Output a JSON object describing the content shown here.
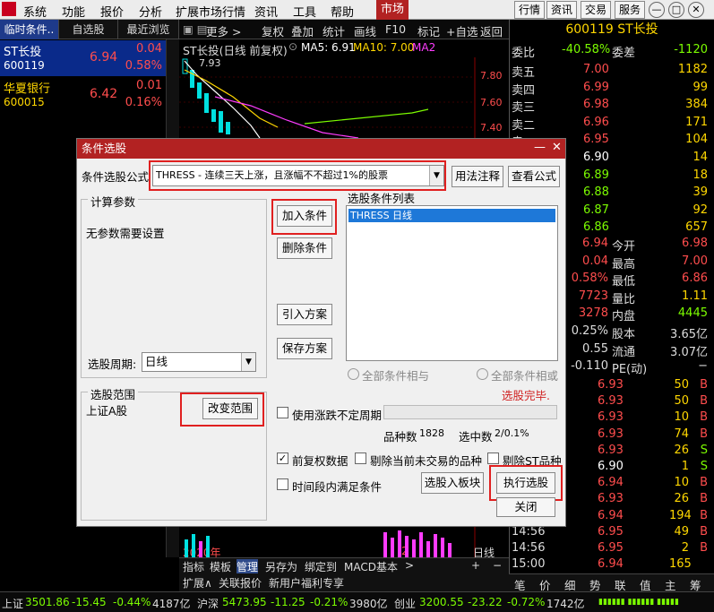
{
  "menubar": {
    "items": [
      "系统",
      "功能",
      "报价",
      "分析",
      "扩展市场行情",
      "资讯",
      "工具",
      "帮助"
    ],
    "market": "市场",
    "right_buttons": [
      "行情",
      "资讯",
      "交易",
      "服务"
    ],
    "window_controls": [
      "—",
      "□",
      "✕"
    ]
  },
  "left_tabs": [
    "临时条件..",
    "自选股",
    "最近浏览"
  ],
  "stocks": [
    {
      "name": "ST长投",
      "code": "600119",
      "price": "6.94",
      "change": "0.04",
      "pct": "0.58%"
    },
    {
      "name": "华夏银行",
      "code": "600015",
      "price": "6.42",
      "change": "0.01",
      "pct": "0.16%"
    }
  ],
  "chart_toolbar": {
    "more": "更多 >",
    "items": [
      "复权",
      "叠加",
      "统计",
      "画线",
      "F10",
      "标记",
      "+自选",
      "返回"
    ]
  },
  "chart": {
    "title": "ST长投(日线 前复权)",
    "ma5": "MA5: 6.91",
    "ma10": "MA10: 7.00",
    "ma2": "MA2",
    "high_label": "7.93",
    "prices": [
      "7.80",
      "7.60",
      "7.40"
    ],
    "year": "2020年",
    "right_label": "日线",
    "small_label": "2"
  },
  "chart_bottom": [
    "指标",
    "模板",
    "管理",
    "另存为",
    "绑定到",
    "MACD基本",
    ">",
    "+",
    "−"
  ],
  "ext_bar": [
    "扩展∧",
    "关联报价",
    "新用户福利专享"
  ],
  "right": {
    "header": "600119 ST长投",
    "webi": {
      "label": "委比",
      "value": "-40.58%",
      "label2": "委差",
      "value2": "-1120"
    },
    "sell": [
      {
        "l": "卖五",
        "p": "7.00",
        "v": "1182"
      },
      {
        "l": "卖四",
        "p": "6.99",
        "v": "99"
      },
      {
        "l": "卖三",
        "p": "6.98",
        "v": "384"
      },
      {
        "l": "卖二",
        "p": "6.96",
        "v": "171"
      },
      {
        "l": "卖一",
        "p": "6.95",
        "v": "104"
      }
    ],
    "buy": [
      {
        "p": "6.90",
        "v": "14"
      },
      {
        "p": "6.89",
        "v": "18"
      },
      {
        "p": "6.88",
        "v": "39"
      },
      {
        "p": "6.87",
        "v": "92"
      },
      {
        "p": "6.86",
        "v": "657"
      }
    ],
    "info": [
      {
        "a": "6.94",
        "l": "今开",
        "b": "6.98"
      },
      {
        "a": "0.04",
        "l": "最高",
        "b": "7.00"
      },
      {
        "a": "0.58%",
        "l": "最低",
        "b": "6.86"
      },
      {
        "a": "7723",
        "l": "量比",
        "b": "1.11"
      },
      {
        "a": "3278",
        "l": "内盘",
        "b": "4445"
      }
    ],
    "info2": [
      {
        "a": "0.25%",
        "l": "股本",
        "b": "3.65亿"
      },
      {
        "a": "0.55",
        "l": "流通",
        "b": "3.07亿"
      },
      {
        "a": "-0.110",
        "l": "PE(动)",
        "b": "−"
      }
    ],
    "ticks": [
      {
        "t": "",
        "p": "6.93",
        "v": "50",
        "s": "B"
      },
      {
        "t": "",
        "p": "6.93",
        "v": "50",
        "s": "B"
      },
      {
        "t": "",
        "p": "6.93",
        "v": "10",
        "s": "B"
      },
      {
        "t": "",
        "p": "6.93",
        "v": "74",
        "s": "B"
      },
      {
        "t": "",
        "p": "6.93",
        "v": "26",
        "s": "S"
      },
      {
        "t": "",
        "p": "6.90",
        "v": "1",
        "s": "S"
      },
      {
        "t": "",
        "p": "6.94",
        "v": "10",
        "s": "B"
      },
      {
        "t": "",
        "p": "6.93",
        "v": "26",
        "s": "B"
      },
      {
        "t": "",
        "p": "6.94",
        "v": "194",
        "s": "B"
      },
      {
        "t": "14:56",
        "p": "6.95",
        "v": "49",
        "s": "B"
      },
      {
        "t": "14:56",
        "p": "6.95",
        "v": "2",
        "s": "B"
      },
      {
        "t": "15:00",
        "p": "6.94",
        "v": "165",
        "s": ""
      }
    ],
    "bottom_tabs": [
      "笔",
      "价",
      "细",
      "势",
      "联",
      "值",
      "主",
      "筹"
    ]
  },
  "dialog": {
    "title": "条件选股",
    "formula_label": "条件选股公式",
    "formula_value": "THRESS      - 连续三天上涨，且涨幅不不超过1%的股票",
    "btn_usage": "用法注释",
    "btn_view": "查看公式",
    "calc_params": "计算参数",
    "no_params": "无参数需要设置",
    "btn_add": "加入条件",
    "btn_delete": "删除条件",
    "btn_import": "引入方案",
    "btn_save": "保存方案",
    "cond_list_label": "选股条件列表",
    "cond_items": [
      "THRESS  日线"
    ],
    "period_label": "选股周期:",
    "period_value": "日线",
    "radio_and": "全部条件相与",
    "radio_or": "全部条件相或",
    "done": "选股完毕.",
    "scope_label": "选股范围",
    "scope_value": "上证A股",
    "btn_scope": "改变范围",
    "chk_unfixed": "使用涨跌不定周期",
    "count_label": "品种数",
    "count_value": "1828",
    "selected_label": "选中数",
    "selected_value": "2/0.1%",
    "chk_prev": "前复权数据",
    "chk_exclude": "剔除当前未交易的品种",
    "chk_st": "剔除ST品种",
    "chk_period": "时间段内满足条件",
    "btn_to_block": "选股入板块",
    "btn_exec": "执行选股",
    "btn_close": "关闭"
  },
  "status": {
    "sh": {
      "name": "上证",
      "val": "3501.86",
      "chg": "-15.45",
      "pct": "-0.44%",
      "amt": "4187亿"
    },
    "hs": {
      "name": "沪深",
      "val": "5473.95",
      "chg": "-11.25",
      "pct": "-0.21%",
      "amt": "3980亿"
    },
    "cy": {
      "name": "创业",
      "val": "3200.55",
      "chg": "-23.22",
      "pct": "-0.72%",
      "amt": "1742亿"
    }
  }
}
